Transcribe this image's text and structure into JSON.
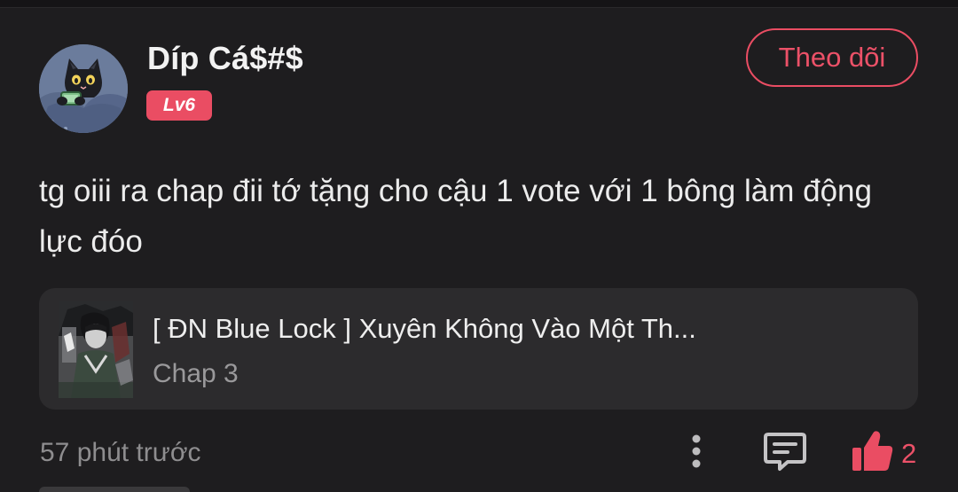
{
  "comment": {
    "user": {
      "name": "Díp Cá$#$",
      "level": "Lv6",
      "avatar_icon": "black-cat-avatar"
    },
    "follow_label": "Theo dõi",
    "text": "tg oiii ra chap đii tớ tặng cho cậu 1 vote với 1 bông làm động lực đóo",
    "story": {
      "title": "[ ĐN Blue Lock ] Xuyên Không Vào Một Th...",
      "chapter": "Chap 3",
      "cover_icon": "manga-cover-image"
    },
    "time": "57 phút trước",
    "actions": {
      "more_icon": "more-vertical-icon",
      "reply_icon": "comment-reply-icon",
      "like_icon": "thumbs-up-icon",
      "like_count": "2"
    }
  },
  "colors": {
    "background": "#1e1d1f",
    "accent": "#ea4d63",
    "card": "#2c2b2d",
    "muted_text": "#8e8d8f"
  }
}
